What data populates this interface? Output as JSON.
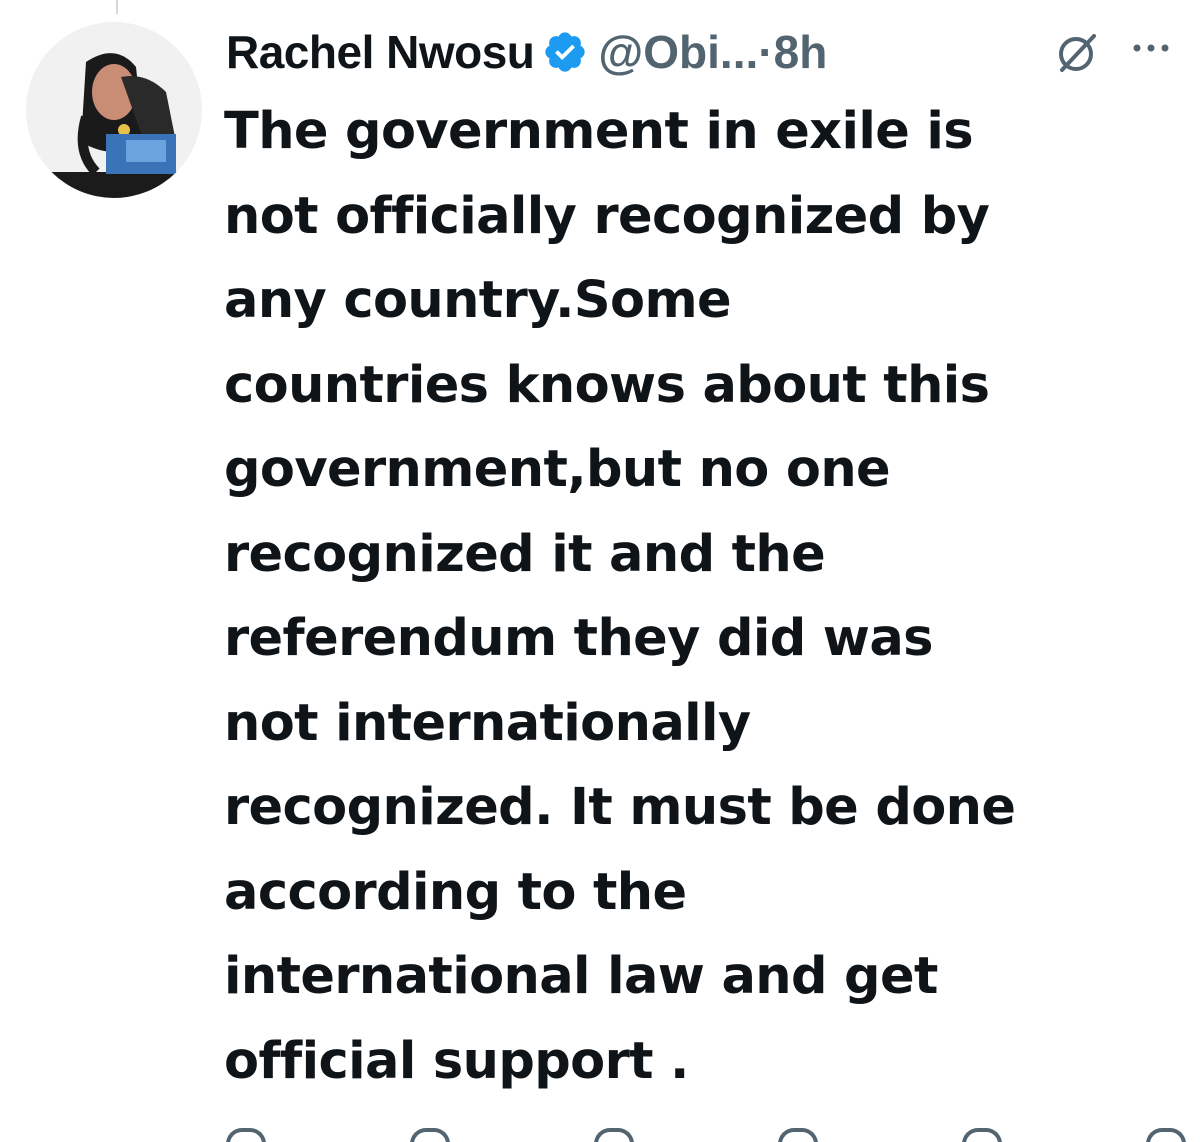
{
  "tweet": {
    "author_name": "Rachel Nwosu",
    "handle": "@Obi...",
    "separator": "·",
    "timestamp": "8h",
    "verified": true,
    "text_lines": [
      "The government in exile is",
      "not officially recognized by",
      "any country.Some",
      "countries knows about this",
      "government,but no one",
      "recognized it and the",
      "referendum they did was",
      "not internationally",
      "recognized. It must be done",
      "according to the",
      "international law and get",
      "official support ."
    ]
  },
  "icons": {
    "verified": "verified-badge-icon",
    "grok": "grok-icon",
    "more": "more-options-icon",
    "reply": "reply-icon",
    "retweet": "retweet-icon",
    "like": "like-icon",
    "views": "views-icon",
    "bookmark": "bookmark-icon",
    "share": "share-icon"
  },
  "colors": {
    "text": "#0f1419",
    "secondary": "#536471",
    "verified": "#1d9bf0",
    "background": "#ffffff"
  }
}
